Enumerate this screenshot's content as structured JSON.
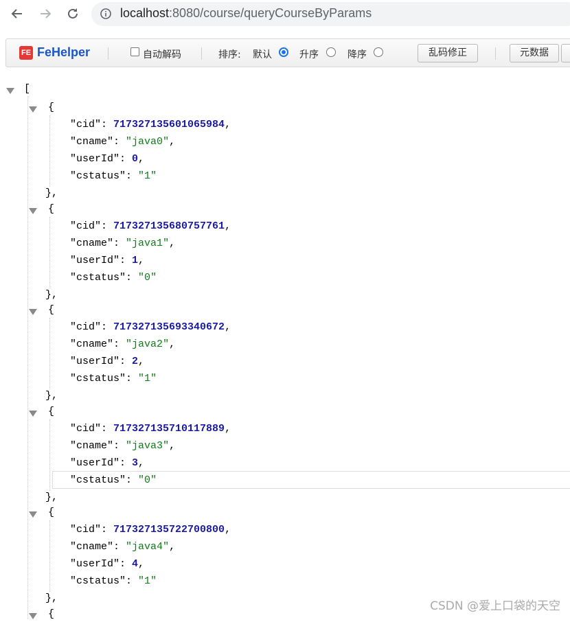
{
  "browser": {
    "url_host": "localhost",
    "url_path": ":8080/course/queryCourseByParams",
    "icons": [
      "back-arrow-icon",
      "forward-arrow-icon",
      "reload-icon",
      "info-icon"
    ]
  },
  "fehelper": {
    "logo_text": "FE",
    "title": "FeHelper",
    "auto_decode_label": "自动解码",
    "sort_label": "排序:",
    "sort_options": [
      {
        "label": "默认",
        "selected": true
      },
      {
        "label": "升序",
        "selected": false
      },
      {
        "label": "降序",
        "selected": false
      }
    ],
    "fix_garbled_button": "乱码修正",
    "metadata_button": "元数据",
    "accent_color": "#1a56c6"
  },
  "json": {
    "open_bracket": "[",
    "records": [
      {
        "cid": "717327135601065984",
        "cname": "java0",
        "userId": "0",
        "cstatus": "1"
      },
      {
        "cid": "717327135680757761",
        "cname": "java1",
        "userId": "1",
        "cstatus": "0"
      },
      {
        "cid": "717327135693340672",
        "cname": "java2",
        "userId": "2",
        "cstatus": "1"
      },
      {
        "cid": "717327135710117889",
        "cname": "java3",
        "userId": "3",
        "cstatus": "0"
      },
      {
        "cid": "717327135722700800",
        "cname": "java4",
        "userId": "4",
        "cstatus": "1"
      }
    ],
    "colors": {
      "number": "#1a1aa6",
      "string": "#0a7f12"
    }
  },
  "watermark": "CSDN @爱上口袋的天空"
}
